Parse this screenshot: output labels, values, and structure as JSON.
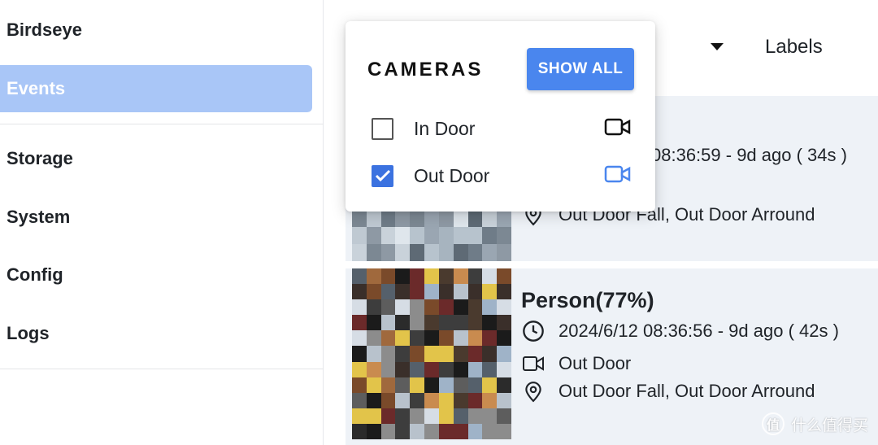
{
  "sidebar": {
    "items": [
      {
        "label": "Birdseye",
        "active": false
      },
      {
        "label": "Events",
        "active": true
      },
      {
        "label": "Storage",
        "active": false
      },
      {
        "label": "System",
        "active": false
      },
      {
        "label": "Config",
        "active": false
      },
      {
        "label": "Logs",
        "active": false
      }
    ],
    "active_color": "#a9c6f7"
  },
  "header": {
    "labels_label": "Labels"
  },
  "cameras_popup": {
    "title": "CAMERAS",
    "show_all_label": "SHOW ALL",
    "accent_color": "#4a86ee",
    "cameras": [
      {
        "name": "In Door",
        "checked": false,
        "icon": "video-camera-icon"
      },
      {
        "name": "Out Door",
        "checked": true,
        "icon": "video-camera-icon"
      }
    ]
  },
  "events": [
    {
      "title_partial": "%)",
      "time_partial": "08:36:59 - 9d ago  ( 34s )",
      "zones": "Out Door Fall, Out Door Arround"
    },
    {
      "title": "Person(77%)",
      "time": "2024/6/12 08:36:56 - 9d ago  ( 42s )",
      "camera": "Out Door",
      "zones": "Out Door Fall, Out Door Arround"
    }
  ],
  "watermark": {
    "badge": "值",
    "text": "什么值得买"
  }
}
